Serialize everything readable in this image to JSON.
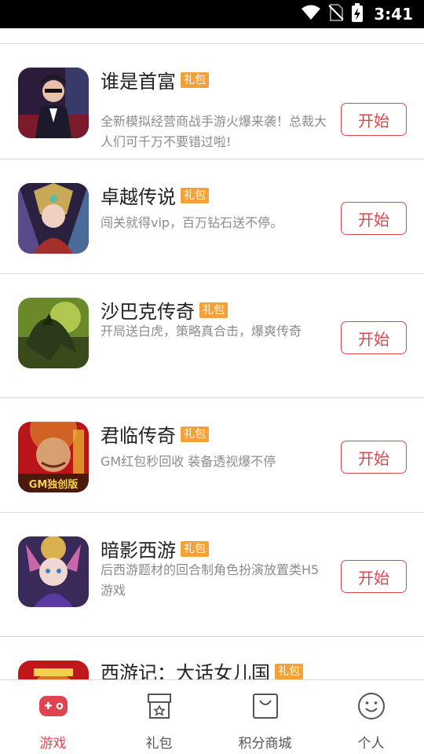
{
  "statusbar": {
    "time": "3:41"
  },
  "games": [
    {
      "title": "谁是首富",
      "badge": "礼包",
      "desc": "全新模拟经营商战手游火爆来袭！总裁大人们可千万不要错过啦!",
      "button": "开始"
    },
    {
      "title": "卓越传说",
      "badge": "礼包",
      "desc": "闯关就得vip，百万钻石送不停。",
      "button": "开始"
    },
    {
      "title": "沙巴克传奇",
      "badge": "礼包",
      "desc": "开局送白虎，策略真合击，爆爽传奇",
      "button": "开始"
    },
    {
      "title": "君临传奇",
      "badge": "礼包",
      "desc": "GM红包秒回收 装备透视爆不停",
      "button": "开始",
      "icon_text": "GM独创版"
    },
    {
      "title": "暗影西游",
      "badge": "礼包",
      "desc": "后西游题材的回合制角色扮演放置类H5游戏",
      "button": "开始"
    },
    {
      "title": "西游记：大话女儿国",
      "badge": "礼包"
    }
  ],
  "nav": {
    "games": "游戏",
    "gifts": "礼包",
    "points_mall": "积分商城",
    "profile": "个人"
  },
  "colors": {
    "accent": "#e0454f",
    "badge": "#f5a13a"
  }
}
